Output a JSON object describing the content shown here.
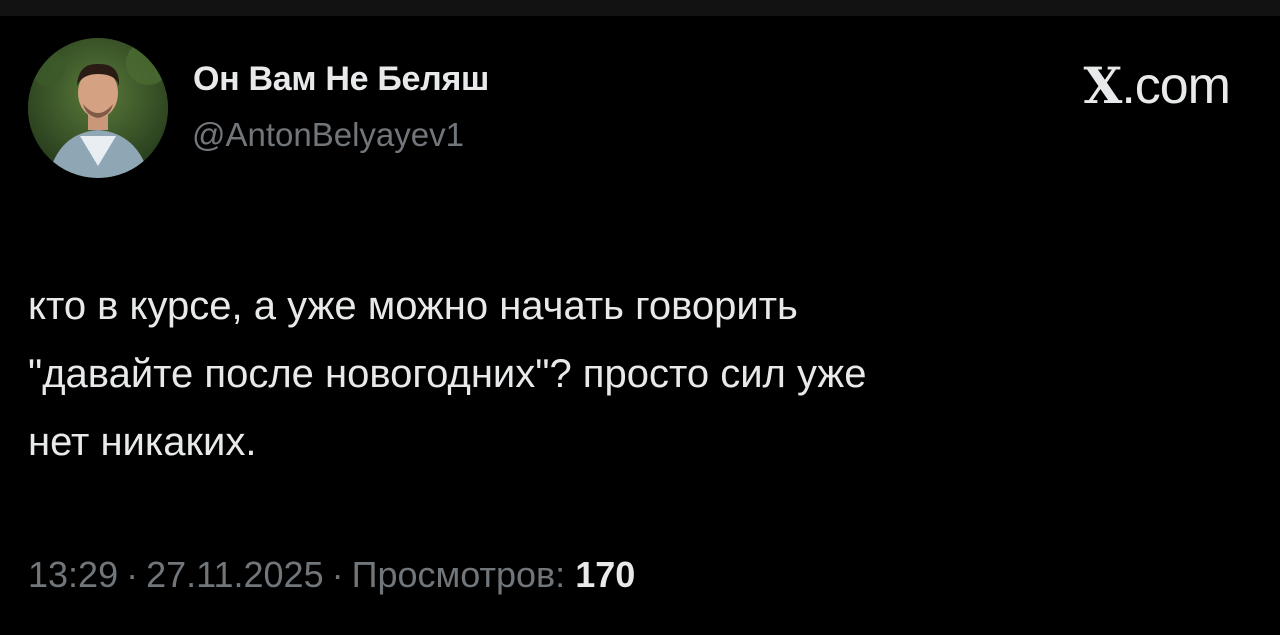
{
  "author": {
    "display_name": "Он Вам Не Беляш",
    "handle": "@AntonBelyayev1",
    "avatar_icon": "user-avatar-photo"
  },
  "brand": {
    "label": ".com",
    "x_letter": "X"
  },
  "tweet": {
    "text": "кто в курсе, а уже можно начать говорить\n\"давайте после новогодних\"? просто сил уже\nнет никаких."
  },
  "meta": {
    "time": "13:29",
    "separator": "·",
    "date": "27.11.2025",
    "views_label": "Просмотров:",
    "views_count": "170"
  },
  "colors": {
    "background": "#000000",
    "text_primary": "#e7e9ea",
    "text_secondary": "#71767b"
  }
}
